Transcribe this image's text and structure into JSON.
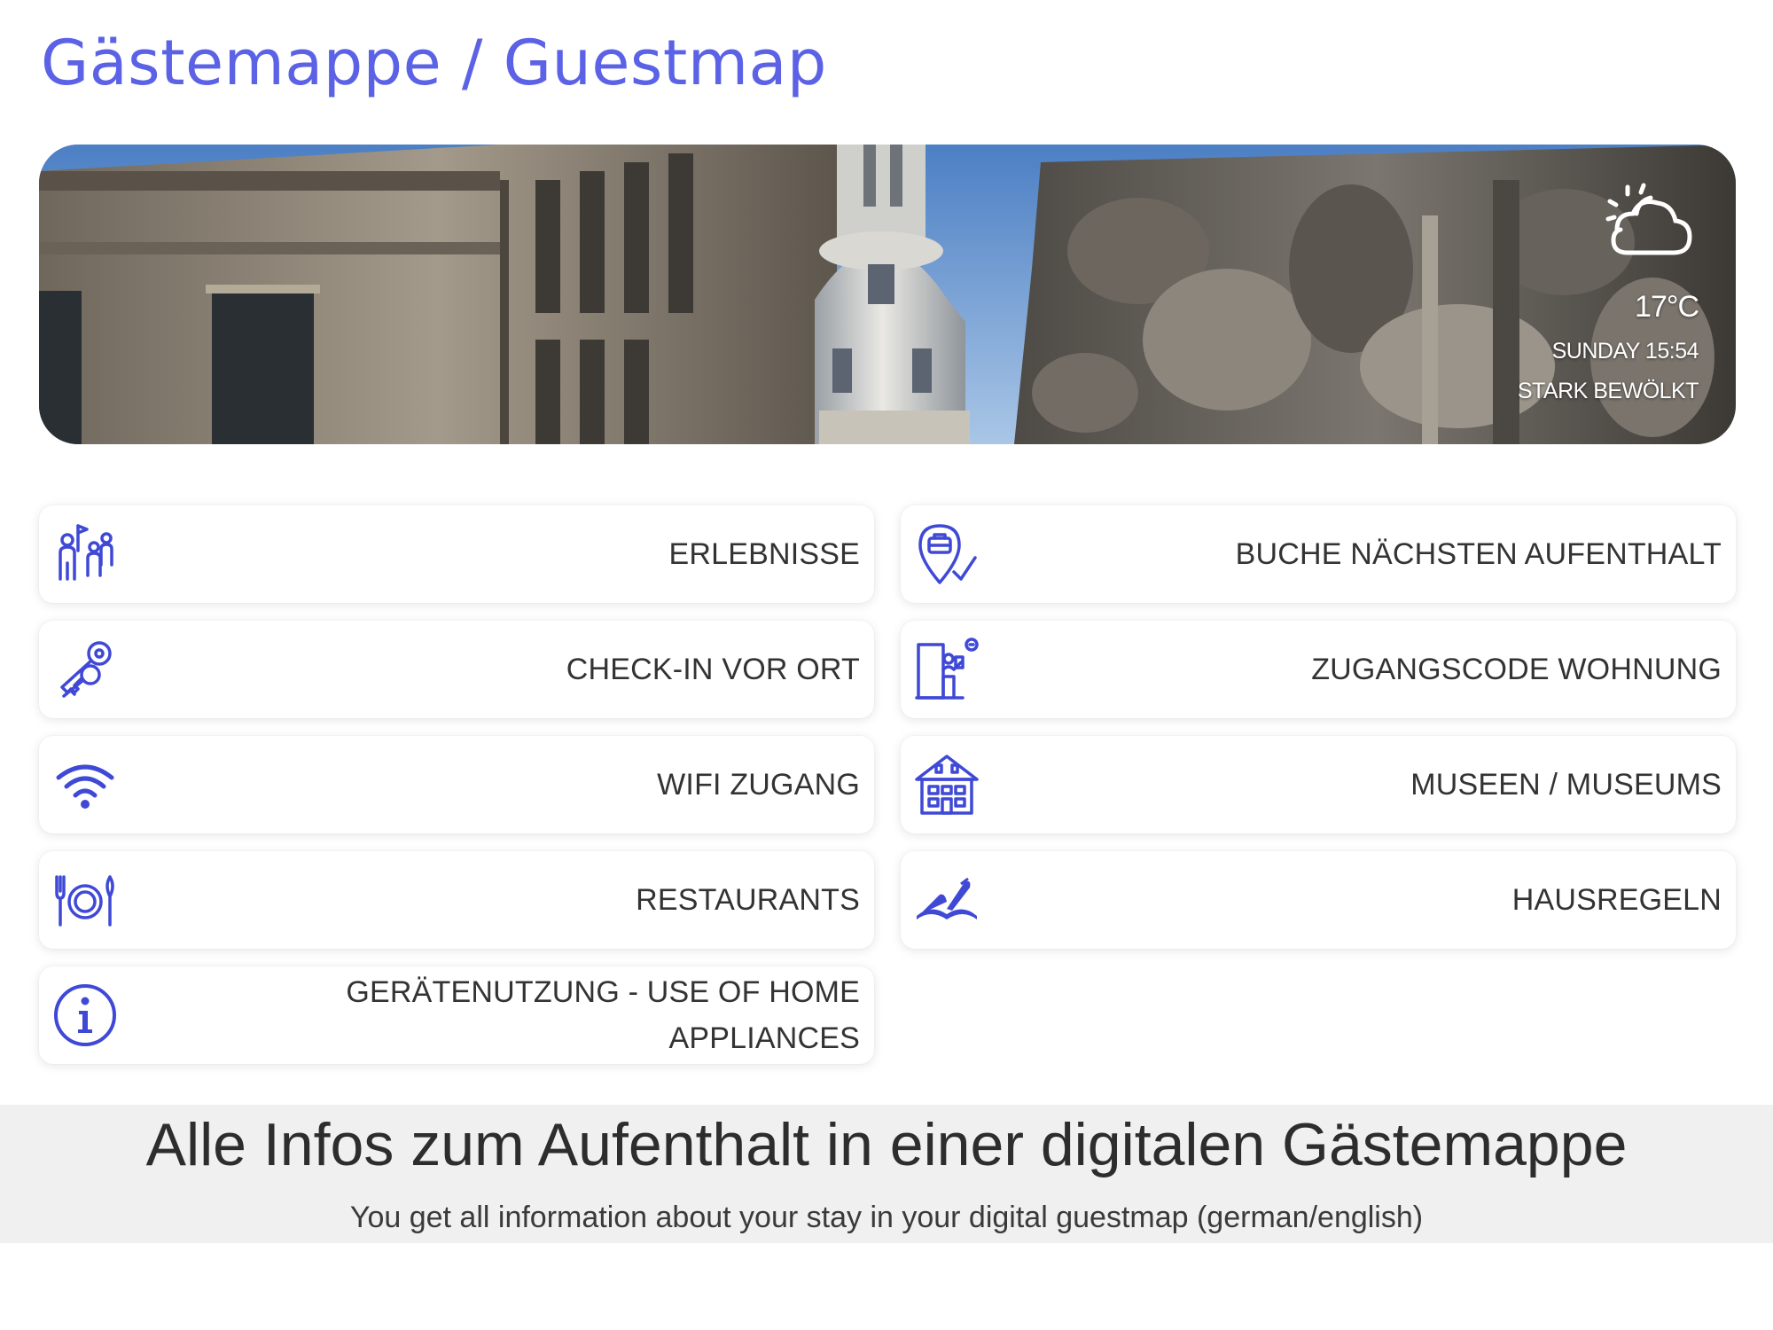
{
  "header": {
    "title": "Gästemappe / Guestmap"
  },
  "weather": {
    "icon": "partly-cloudy-icon",
    "temperature": "17°C",
    "datetime": "SUNDAY 15:54",
    "description": "STARK BEWÖLKT"
  },
  "menu": {
    "left": [
      {
        "label": "ERLEBNISSE",
        "icon": "tour-group-icon"
      },
      {
        "label": "CHECK-IN VOR ORT",
        "icon": "keys-icon"
      },
      {
        "label": "WIFI ZUGANG",
        "icon": "wifi-icon"
      },
      {
        "label": "RESTAURANTS",
        "icon": "dining-icon"
      },
      {
        "label": "GERÄTENUTZUNG - USE OF HOME APPLIANCES",
        "icon": "info-icon"
      }
    ],
    "right": [
      {
        "label": "BUCHE NÄCHSTEN AUFENTHALT",
        "icon": "booking-pin-icon"
      },
      {
        "label": "ZUGANGSCODE WOHNUNG",
        "icon": "door-code-icon"
      },
      {
        "label": "MUSEEN / MUSEUMS",
        "icon": "museum-building-icon"
      },
      {
        "label": "HAUSREGELN",
        "icon": "book-quill-icon"
      }
    ]
  },
  "footer": {
    "headline": "Alle Infos zum Aufenthalt in einer digitalen Gästemappe",
    "subline": "You get all information about your stay in your digital guestmap (german/english)"
  },
  "colors": {
    "accent": "#5b62e6",
    "icon": "#3f49d6",
    "footer_band": "#f0f0f0"
  }
}
